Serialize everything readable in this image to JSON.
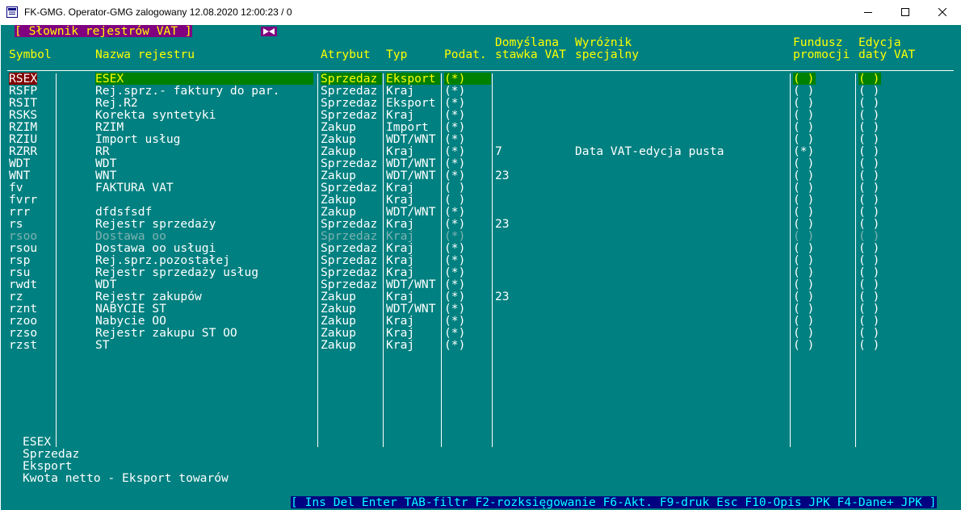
{
  "window": {
    "title": "FK-GMG. Operator-GMG zalogowany 12.08.2020 12:00:23 / 0"
  },
  "dialog": {
    "title": "[ Słownik rejestrów VAT ]"
  },
  "columns": {
    "symbol": "Symbol",
    "nazwa": "Nazwa rejestru",
    "atrybut": "Atrybut",
    "typ": "Typ",
    "podat": "Podat.",
    "stawka_1": "Domyślana",
    "stawka_2": "stawka VAT",
    "wyroznik_1": "Wyróżnik",
    "wyroznik_2": "specjalny",
    "fundusz_1": "Fundusz",
    "fundusz_2": "promocji",
    "edycja_1": "Edycja",
    "edycja_2": "daty VAT"
  },
  "rows": [
    {
      "symbol": "RSEX",
      "nazwa": "ESEX",
      "atrybut": "Sprzedaz",
      "typ": "Eksport",
      "podat": "(*)",
      "stawka": "",
      "wyroznik": "",
      "fundusz": "( )",
      "edycja": "( )"
    },
    {
      "symbol": "RSFP",
      "nazwa": "Rej.sprz.- faktury do par.",
      "atrybut": "Sprzedaz",
      "typ": "Kraj",
      "podat": "(*)",
      "stawka": "",
      "wyroznik": "",
      "fundusz": "( )",
      "edycja": "( )"
    },
    {
      "symbol": "RSIT",
      "nazwa": "Rej.R2",
      "atrybut": "Sprzedaz",
      "typ": "Eksport",
      "podat": "(*)",
      "stawka": "",
      "wyroznik": "",
      "fundusz": "( )",
      "edycja": "( )"
    },
    {
      "symbol": "RSKS",
      "nazwa": "Korekta syntetyki",
      "atrybut": "Sprzedaz",
      "typ": "Kraj",
      "podat": "(*)",
      "stawka": "",
      "wyroznik": "",
      "fundusz": "( )",
      "edycja": "( )"
    },
    {
      "symbol": "RZIM",
      "nazwa": "RZIM",
      "atrybut": "Zakup",
      "typ": "Import",
      "podat": "(*)",
      "stawka": "",
      "wyroznik": "",
      "fundusz": "( )",
      "edycja": "( )"
    },
    {
      "symbol": "RZIU",
      "nazwa": "Import usług",
      "atrybut": "Zakup",
      "typ": "WDT/WNT",
      "podat": "(*)",
      "stawka": "",
      "wyroznik": "",
      "fundusz": "( )",
      "edycja": "( )"
    },
    {
      "symbol": "RZRR",
      "nazwa": "RR",
      "atrybut": "Zakup",
      "typ": "Kraj",
      "podat": "(*)",
      "stawka": "7",
      "wyroznik": "Data VAT-edycja pusta",
      "fundusz": "(*)",
      "edycja": "( )"
    },
    {
      "symbol": "WDT",
      "nazwa": "WDT",
      "atrybut": "Sprzedaz",
      "typ": "WDT/WNT",
      "podat": "(*)",
      "stawka": "",
      "wyroznik": "",
      "fundusz": "( )",
      "edycja": "( )"
    },
    {
      "symbol": "WNT",
      "nazwa": "WNT",
      "atrybut": "Zakup",
      "typ": "WDT/WNT",
      "podat": "(*)",
      "stawka": "23",
      "wyroznik": "",
      "fundusz": "( )",
      "edycja": "( )"
    },
    {
      "symbol": "fv",
      "nazwa": "FAKTURA VAT",
      "atrybut": "Sprzedaz",
      "typ": "Kraj",
      "podat": "( )",
      "stawka": "",
      "wyroznik": "",
      "fundusz": "( )",
      "edycja": "( )"
    },
    {
      "symbol": "fvrr",
      "nazwa": "",
      "atrybut": "Zakup",
      "typ": "Kraj",
      "podat": "( )",
      "stawka": "",
      "wyroznik": "",
      "fundusz": "( )",
      "edycja": "( )"
    },
    {
      "symbol": "rrr",
      "nazwa": "dfdsfsdf",
      "atrybut": "Zakup",
      "typ": "WDT/WNT",
      "podat": "(*)",
      "stawka": "",
      "wyroznik": "",
      "fundusz": "( )",
      "edycja": "( )"
    },
    {
      "symbol": "rs",
      "nazwa": "Rejestr sprzedaży",
      "atrybut": "Sprzedaz",
      "typ": "Kraj",
      "podat": "(*)",
      "stawka": "23",
      "wyroznik": "",
      "fundusz": "( )",
      "edycja": "( )"
    },
    {
      "symbol": "rsoo",
      "nazwa": "Dostawa oo",
      "atrybut": "Sprzedaz",
      "typ": "Kraj",
      "podat": "(*)",
      "stawka": "",
      "wyroznik": "",
      "fundusz": "( )",
      "edycja": "( )"
    },
    {
      "symbol": "rsou",
      "nazwa": "Dostawa oo usługi",
      "atrybut": "Sprzedaz",
      "typ": "Kraj",
      "podat": "(*)",
      "stawka": "",
      "wyroznik": "",
      "fundusz": "( )",
      "edycja": "( )"
    },
    {
      "symbol": "rsp",
      "nazwa": "Rej.sprz.pozostałej",
      "atrybut": "Sprzedaz",
      "typ": "Kraj",
      "podat": "(*)",
      "stawka": "",
      "wyroznik": "",
      "fundusz": "( )",
      "edycja": "( )"
    },
    {
      "symbol": "rsu",
      "nazwa": "Rejestr sprzedaży usług",
      "atrybut": "Sprzedaz",
      "typ": "Kraj",
      "podat": "(*)",
      "stawka": "",
      "wyroznik": "",
      "fundusz": "( )",
      "edycja": "( )"
    },
    {
      "symbol": "rwdt",
      "nazwa": "WDT",
      "atrybut": "Sprzedaz",
      "typ": "WDT/WNT",
      "podat": "(*)",
      "stawka": "",
      "wyroznik": "",
      "fundusz": "( )",
      "edycja": "( )"
    },
    {
      "symbol": "rz",
      "nazwa": "Rejestr zakupów",
      "atrybut": "Zakup",
      "typ": "Kraj",
      "podat": "(*)",
      "stawka": "23",
      "wyroznik": "",
      "fundusz": "( )",
      "edycja": "( )"
    },
    {
      "symbol": "rznt",
      "nazwa": "NABYCIE ST",
      "atrybut": "Zakup",
      "typ": "WDT/WNT",
      "podat": "(*)",
      "stawka": "",
      "wyroznik": "",
      "fundusz": "( )",
      "edycja": "( )"
    },
    {
      "symbol": "rzoo",
      "nazwa": "Nabycie OO",
      "atrybut": "Zakup",
      "typ": "Kraj",
      "podat": "(*)",
      "stawka": "",
      "wyroznik": "",
      "fundusz": "( )",
      "edycja": "( )"
    },
    {
      "symbol": "rzso",
      "nazwa": "Rejestr zakupu ST OO",
      "atrybut": "Zakup",
      "typ": "Kraj",
      "podat": "(*)",
      "stawka": "",
      "wyroznik": "",
      "fundusz": "( )",
      "edycja": "( )"
    },
    {
      "symbol": "rzst",
      "nazwa": "ST",
      "atrybut": "Zakup",
      "typ": "Kraj",
      "podat": "(*)",
      "stawka": "",
      "wyroznik": "",
      "fundusz": "( )",
      "edycja": "( )"
    }
  ],
  "selected_row": 0,
  "dimmed_row": 13,
  "details": {
    "line1": "ESEX",
    "line2": "Sprzedaz",
    "line3": "Eksport",
    "line4": "Kwota netto - Eksport towarów"
  },
  "statusbar": "[ Ins Del Enter TAB-filtr F2-rozksięgowanie F6-Akt. F9-druk Esc F10-Opis JPK F4-Dane+ JPK ]",
  "icons": [
    "app-icon",
    "minimize-icon",
    "maximize-icon",
    "close-icon",
    "bowtie-icon"
  ],
  "colors": {
    "background": "#008080",
    "header_text": "#ffff00",
    "selection": "#008000",
    "selected_symbol": "#800000",
    "dialog_title_bg": "#800080",
    "statusbar_bg": "#000080",
    "statusbar_text": "#00ffff"
  }
}
